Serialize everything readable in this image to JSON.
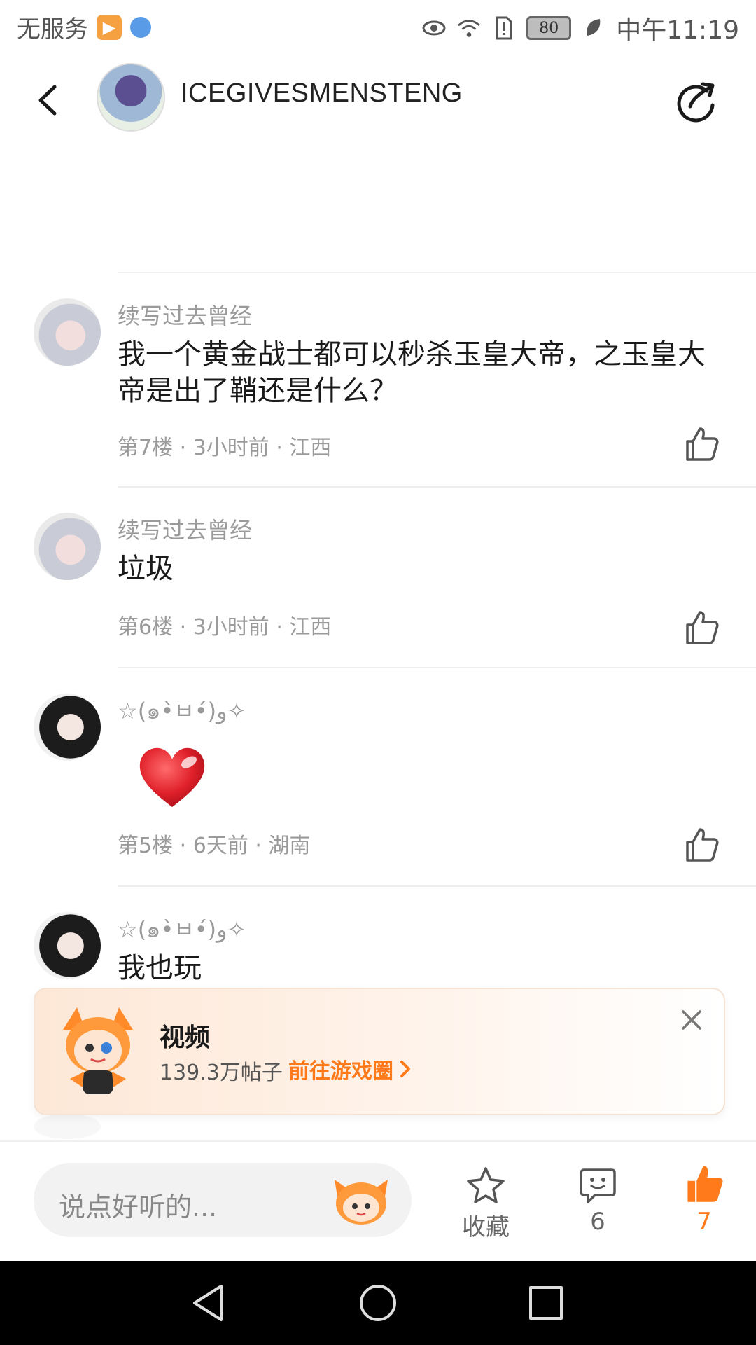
{
  "status_bar": {
    "carrier": "无服务",
    "battery": "80",
    "time": "中午11:19"
  },
  "header": {
    "username": "ICEGIVESMENSTENG"
  },
  "comments": [
    {
      "name": "续写过去曾经",
      "text": "我一个黄金战士都可以秒杀玉皇大帝，之玉皇大帝是出了鞘还是什么？",
      "meta": "第7楼 · 3小时前 · 江西"
    },
    {
      "name": "续写过去曾经",
      "text": "垃圾",
      "meta": "第6楼 · 3小时前 · 江西"
    },
    {
      "name": "☆(๑•̀ㅂ•́)و✧",
      "text": "",
      "meta": "第5楼 · 6天前 · 湖南",
      "emoji": "heart"
    },
    {
      "name": "☆(๑•̀ㅂ•́)و✧",
      "text": "我也玩",
      "meta": ""
    }
  ],
  "banner": {
    "title": "视频",
    "posts": "139.3万帖子",
    "link": "前往游戏圈"
  },
  "bottom_bar": {
    "input_placeholder": "说点好听的...",
    "favorite_label": "收藏",
    "comment_count": "6",
    "like_count": "7",
    "like_color": "#ff7a1a"
  }
}
